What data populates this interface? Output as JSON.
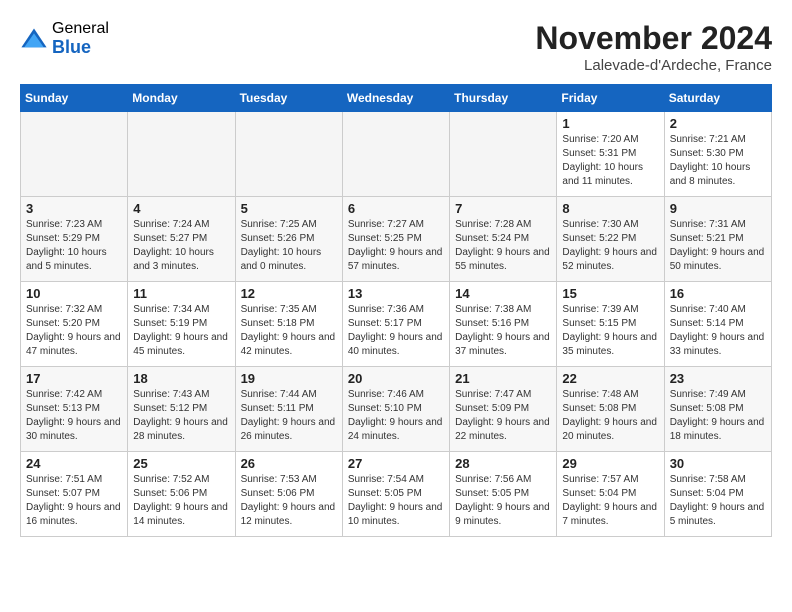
{
  "header": {
    "logo_general": "General",
    "logo_blue": "Blue",
    "month_title": "November 2024",
    "location": "Lalevade-d'Ardeche, France"
  },
  "weekdays": [
    "Sunday",
    "Monday",
    "Tuesday",
    "Wednesday",
    "Thursday",
    "Friday",
    "Saturday"
  ],
  "weeks": [
    [
      {
        "day": "",
        "empty": true
      },
      {
        "day": "",
        "empty": true
      },
      {
        "day": "",
        "empty": true
      },
      {
        "day": "",
        "empty": true
      },
      {
        "day": "",
        "empty": true
      },
      {
        "day": "1",
        "sunrise": "7:20 AM",
        "sunset": "5:31 PM",
        "daylight": "10 hours and 11 minutes."
      },
      {
        "day": "2",
        "sunrise": "7:21 AM",
        "sunset": "5:30 PM",
        "daylight": "10 hours and 8 minutes."
      }
    ],
    [
      {
        "day": "3",
        "sunrise": "7:23 AM",
        "sunset": "5:29 PM",
        "daylight": "10 hours and 5 minutes."
      },
      {
        "day": "4",
        "sunrise": "7:24 AM",
        "sunset": "5:27 PM",
        "daylight": "10 hours and 3 minutes."
      },
      {
        "day": "5",
        "sunrise": "7:25 AM",
        "sunset": "5:26 PM",
        "daylight": "10 hours and 0 minutes."
      },
      {
        "day": "6",
        "sunrise": "7:27 AM",
        "sunset": "5:25 PM",
        "daylight": "9 hours and 57 minutes."
      },
      {
        "day": "7",
        "sunrise": "7:28 AM",
        "sunset": "5:24 PM",
        "daylight": "9 hours and 55 minutes."
      },
      {
        "day": "8",
        "sunrise": "7:30 AM",
        "sunset": "5:22 PM",
        "daylight": "9 hours and 52 minutes."
      },
      {
        "day": "9",
        "sunrise": "7:31 AM",
        "sunset": "5:21 PM",
        "daylight": "9 hours and 50 minutes."
      }
    ],
    [
      {
        "day": "10",
        "sunrise": "7:32 AM",
        "sunset": "5:20 PM",
        "daylight": "9 hours and 47 minutes."
      },
      {
        "day": "11",
        "sunrise": "7:34 AM",
        "sunset": "5:19 PM",
        "daylight": "9 hours and 45 minutes."
      },
      {
        "day": "12",
        "sunrise": "7:35 AM",
        "sunset": "5:18 PM",
        "daylight": "9 hours and 42 minutes."
      },
      {
        "day": "13",
        "sunrise": "7:36 AM",
        "sunset": "5:17 PM",
        "daylight": "9 hours and 40 minutes."
      },
      {
        "day": "14",
        "sunrise": "7:38 AM",
        "sunset": "5:16 PM",
        "daylight": "9 hours and 37 minutes."
      },
      {
        "day": "15",
        "sunrise": "7:39 AM",
        "sunset": "5:15 PM",
        "daylight": "9 hours and 35 minutes."
      },
      {
        "day": "16",
        "sunrise": "7:40 AM",
        "sunset": "5:14 PM",
        "daylight": "9 hours and 33 minutes."
      }
    ],
    [
      {
        "day": "17",
        "sunrise": "7:42 AM",
        "sunset": "5:13 PM",
        "daylight": "9 hours and 30 minutes."
      },
      {
        "day": "18",
        "sunrise": "7:43 AM",
        "sunset": "5:12 PM",
        "daylight": "9 hours and 28 minutes."
      },
      {
        "day": "19",
        "sunrise": "7:44 AM",
        "sunset": "5:11 PM",
        "daylight": "9 hours and 26 minutes."
      },
      {
        "day": "20",
        "sunrise": "7:46 AM",
        "sunset": "5:10 PM",
        "daylight": "9 hours and 24 minutes."
      },
      {
        "day": "21",
        "sunrise": "7:47 AM",
        "sunset": "5:09 PM",
        "daylight": "9 hours and 22 minutes."
      },
      {
        "day": "22",
        "sunrise": "7:48 AM",
        "sunset": "5:08 PM",
        "daylight": "9 hours and 20 minutes."
      },
      {
        "day": "23",
        "sunrise": "7:49 AM",
        "sunset": "5:08 PM",
        "daylight": "9 hours and 18 minutes."
      }
    ],
    [
      {
        "day": "24",
        "sunrise": "7:51 AM",
        "sunset": "5:07 PM",
        "daylight": "9 hours and 16 minutes."
      },
      {
        "day": "25",
        "sunrise": "7:52 AM",
        "sunset": "5:06 PM",
        "daylight": "9 hours and 14 minutes."
      },
      {
        "day": "26",
        "sunrise": "7:53 AM",
        "sunset": "5:06 PM",
        "daylight": "9 hours and 12 minutes."
      },
      {
        "day": "27",
        "sunrise": "7:54 AM",
        "sunset": "5:05 PM",
        "daylight": "9 hours and 10 minutes."
      },
      {
        "day": "28",
        "sunrise": "7:56 AM",
        "sunset": "5:05 PM",
        "daylight": "9 hours and 9 minutes."
      },
      {
        "day": "29",
        "sunrise": "7:57 AM",
        "sunset": "5:04 PM",
        "daylight": "9 hours and 7 minutes."
      },
      {
        "day": "30",
        "sunrise": "7:58 AM",
        "sunset": "5:04 PM",
        "daylight": "9 hours and 5 minutes."
      }
    ]
  ]
}
